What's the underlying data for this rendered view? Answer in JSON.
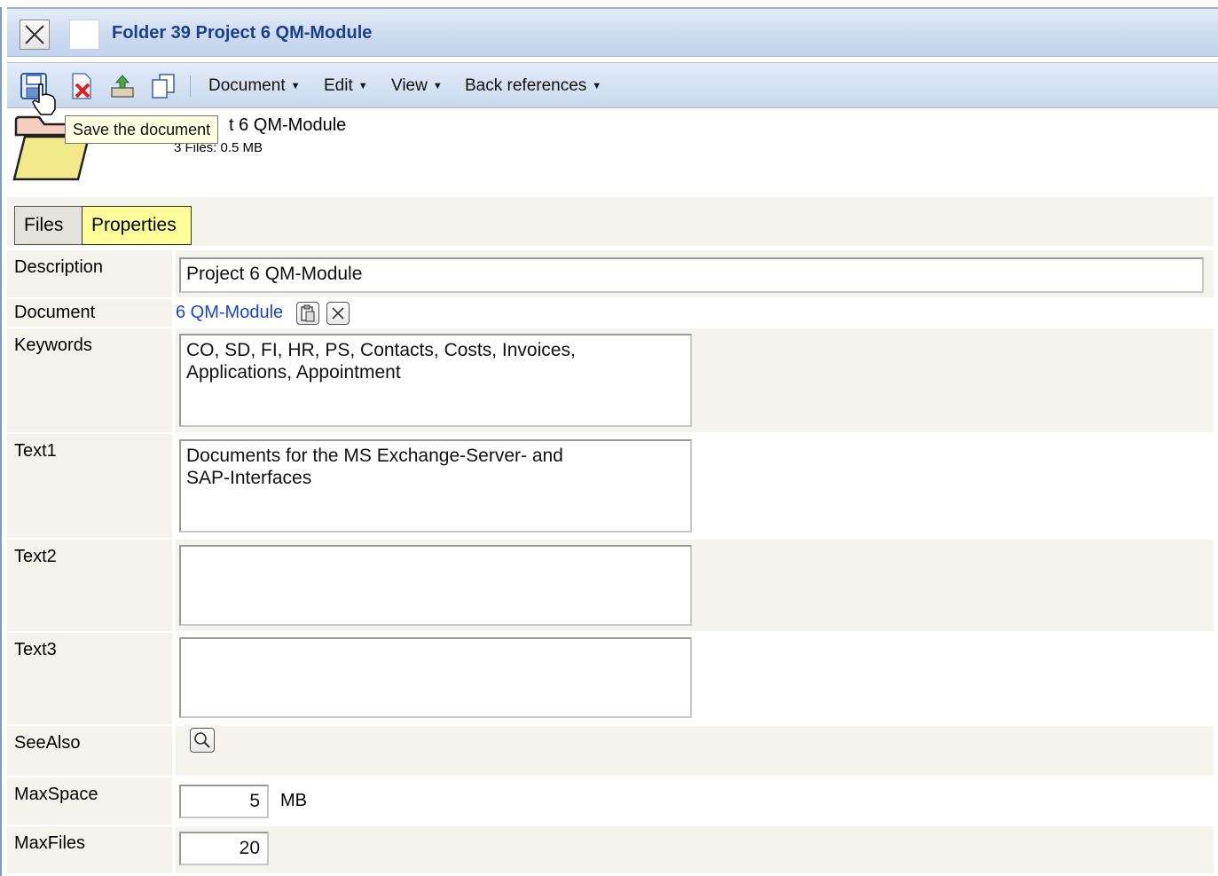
{
  "window": {
    "title": "Folder 39 Project 6 QM-Module"
  },
  "toolbar": {
    "icons": [
      "save-icon",
      "delete-icon",
      "export-icon",
      "copy-icon"
    ],
    "menus": [
      {
        "label": "Document"
      },
      {
        "label": "Edit"
      },
      {
        "label": "View"
      },
      {
        "label": "Back references"
      }
    ],
    "tooltip": "Save the document"
  },
  "header": {
    "name_visible": "t 6 QM-Module",
    "files_info": "3 Files: 0.5 MB"
  },
  "tabs": [
    {
      "label": "Files",
      "active": false
    },
    {
      "label": "Properties",
      "active": true
    }
  ],
  "form": {
    "description": {
      "label": "Description",
      "value": "Project 6 QM-Module"
    },
    "document": {
      "label": "Document",
      "link": "6 QM-Module"
    },
    "keywords": {
      "label": "Keywords",
      "value": "CO, SD, FI, HR, PS, Contacts, Costs, Invoices,\nApplications, Appointment"
    },
    "text1": {
      "label": "Text1",
      "value": "Documents for the MS Exchange-Server- and\nSAP-Interfaces"
    },
    "text2": {
      "label": "Text2",
      "value": ""
    },
    "text3": {
      "label": "Text3",
      "value": ""
    },
    "seealso": {
      "label": "SeeAlso"
    },
    "maxspace": {
      "label": "MaxSpace",
      "value": "5",
      "unit": "MB"
    },
    "maxfiles": {
      "label": "MaxFiles",
      "value": "20"
    }
  },
  "colors": {
    "title_text": "#1b3f8e",
    "link": "#1844c8",
    "tab_active": "#fdfd9a",
    "row_shade": "#f4f4ec",
    "tooltip_bg": "#ffffe1"
  }
}
